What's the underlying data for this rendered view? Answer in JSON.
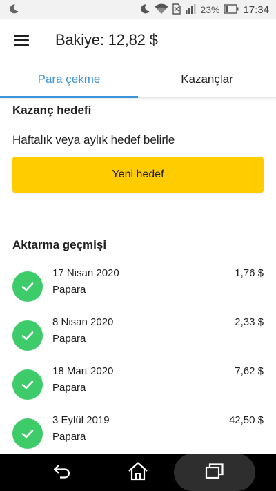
{
  "status_bar": {
    "battery_percent": "23%",
    "time": "17:34"
  },
  "header": {
    "balance": "Bakiye: 12,82 $"
  },
  "tabs": [
    {
      "label": "Para çekme",
      "active": true
    },
    {
      "label": "Kazançlar",
      "active": false
    }
  ],
  "goal": {
    "title": "Kazanç hedefi",
    "subtitle": "Haftalık veya aylık hedef belirle",
    "button_label": "Yeni hedef"
  },
  "history": {
    "title": "Aktarma geçmişi",
    "items": [
      {
        "date": "17 Nisan 2020",
        "method": "Papara",
        "amount": "1,76 $"
      },
      {
        "date": "8 Nisan 2020",
        "method": "Papara",
        "amount": "2,33 $"
      },
      {
        "date": "18 Mart 2020",
        "method": "Papara",
        "amount": "7,62 $"
      },
      {
        "date": "3 Eylül 2019",
        "method": "Papara",
        "amount": "42,50 $"
      }
    ]
  },
  "colors": {
    "accent": "#3e94d8",
    "button": "#ffcc00",
    "success": "#3ecc6a"
  }
}
